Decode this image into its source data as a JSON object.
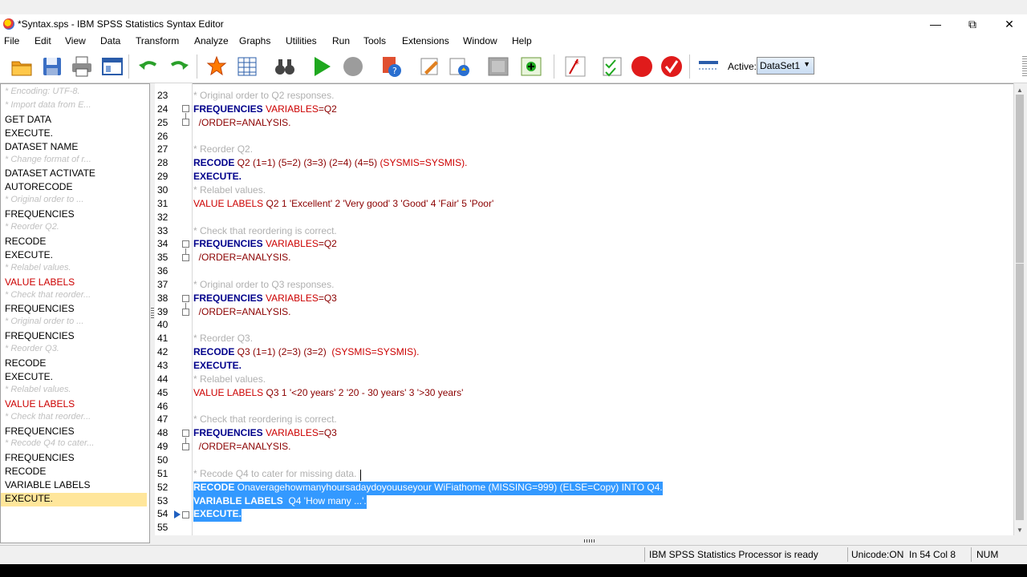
{
  "window": {
    "title": "*Syntax.sps - IBM SPSS Statistics Syntax Editor",
    "controls": {
      "minimize": "—",
      "restore": "⧉",
      "close": "✕"
    }
  },
  "menu": [
    "File",
    "Edit",
    "View",
    "Data",
    "Transform",
    "Analyze",
    "Graphs",
    "Utilities",
    "Run",
    "Tools",
    "Extensions",
    "Window",
    "Help"
  ],
  "toolbar": {
    "active_label": "Active:",
    "active_dataset": "DataSet1",
    "icons": [
      "open-icon",
      "save-icon",
      "print-icon",
      "recall-dialog-icon",
      "undo-icon",
      "redo-icon",
      "goto-case-icon",
      "variables-icon",
      "find-icon",
      "run-icon",
      "stop-icon",
      "help-icon",
      "syntax-help-icon",
      "pencil-icon",
      "bookmark-icon",
      "gray-box-icon",
      "add-icon",
      "comment-icon",
      "validate-icon",
      "breakpoint-icon",
      "check-icon",
      "line-icon"
    ]
  },
  "navigator": [
    {
      "text": "* Encoding: UTF-8.",
      "style": "grey"
    },
    {
      "text": "* Import data from E...",
      "style": "grey"
    },
    {
      "text": "GET DATA",
      "style": ""
    },
    {
      "text": "EXECUTE.",
      "style": ""
    },
    {
      "text": "DATASET NAME",
      "style": ""
    },
    {
      "text": "* Change format of r...",
      "style": "grey"
    },
    {
      "text": "DATASET ACTIVATE",
      "style": ""
    },
    {
      "text": "AUTORECODE",
      "style": ""
    },
    {
      "text": "* Original order to ...",
      "style": "grey"
    },
    {
      "text": "FREQUENCIES",
      "style": ""
    },
    {
      "text": "* Reorder Q2.",
      "style": "grey"
    },
    {
      "text": "RECODE",
      "style": ""
    },
    {
      "text": "EXECUTE.",
      "style": ""
    },
    {
      "text": "* Relabel values.",
      "style": "grey"
    },
    {
      "text": "VALUE LABELS",
      "style": "red"
    },
    {
      "text": "* Check that reorder...",
      "style": "grey"
    },
    {
      "text": "FREQUENCIES",
      "style": ""
    },
    {
      "text": "* Original order to ...",
      "style": "grey"
    },
    {
      "text": "FREQUENCIES",
      "style": ""
    },
    {
      "text": "* Reorder Q3.",
      "style": "grey"
    },
    {
      "text": "RECODE",
      "style": ""
    },
    {
      "text": "EXECUTE.",
      "style": ""
    },
    {
      "text": "* Relabel values.",
      "style": "grey"
    },
    {
      "text": "VALUE LABELS",
      "style": "red"
    },
    {
      "text": "* Check that reorder...",
      "style": "grey"
    },
    {
      "text": "FREQUENCIES",
      "style": ""
    },
    {
      "text": "* Recode Q4 to cater...",
      "style": "grey"
    },
    {
      "text": "FREQUENCIES",
      "style": ""
    },
    {
      "text": "RECODE",
      "style": ""
    },
    {
      "text": "VARIABLE LABELS",
      "style": ""
    },
    {
      "text": "EXECUTE.",
      "style": "sel"
    }
  ],
  "lines": [
    {
      "n": "23",
      "segs": [
        [
          "cm",
          "* Original order to Q2 responses."
        ]
      ]
    },
    {
      "n": "24",
      "segs": [
        [
          "kw",
          "FREQUENCIES"
        ],
        [
          "kr",
          " VARIABLES"
        ],
        [
          "tx",
          "=Q2"
        ]
      ]
    },
    {
      "n": "25",
      "segs": [
        [
          "tx",
          "  /ORDER"
        ],
        [
          "tx",
          "=ANALYSIS."
        ]
      ]
    },
    {
      "n": "26",
      "segs": []
    },
    {
      "n": "27",
      "segs": [
        [
          "cm",
          "* Reorder Q2."
        ]
      ]
    },
    {
      "n": "28",
      "segs": [
        [
          "kw",
          "RECODE"
        ],
        [
          "tx",
          " Q2 (1=1) (5=2) (3=3) (2=4) (4=5) "
        ],
        [
          "kr",
          "(SYSMIS=SYSMIS)."
        ]
      ]
    },
    {
      "n": "29",
      "segs": [
        [
          "kw",
          "EXECUTE."
        ]
      ]
    },
    {
      "n": "30",
      "segs": [
        [
          "cm",
          "* Relabel values."
        ]
      ]
    },
    {
      "n": "31",
      "segs": [
        [
          "kr",
          "VALUE LABELS"
        ],
        [
          "tx",
          " Q2 1 'Excellent' 2 'Very good' 3 'Good' 4 'Fair' 5 'Poor'"
        ]
      ]
    },
    {
      "n": "32",
      "segs": []
    },
    {
      "n": "33",
      "segs": [
        [
          "cm",
          "* Check that reordering is correct."
        ]
      ]
    },
    {
      "n": "34",
      "segs": [
        [
          "kw",
          "FREQUENCIES"
        ],
        [
          "kr",
          " VARIABLES"
        ],
        [
          "tx",
          "=Q2"
        ]
      ]
    },
    {
      "n": "35",
      "segs": [
        [
          "tx",
          "  /ORDER"
        ],
        [
          "tx",
          "=ANALYSIS."
        ]
      ]
    },
    {
      "n": "36",
      "segs": []
    },
    {
      "n": "37",
      "segs": [
        [
          "cm",
          "* Original order to Q3 responses."
        ]
      ]
    },
    {
      "n": "38",
      "segs": [
        [
          "kw",
          "FREQUENCIES"
        ],
        [
          "kr",
          " VARIABLES"
        ],
        [
          "tx",
          "=Q3"
        ]
      ]
    },
    {
      "n": "39",
      "segs": [
        [
          "tx",
          "  /ORDER"
        ],
        [
          "tx",
          "=ANALYSIS."
        ]
      ]
    },
    {
      "n": "40",
      "segs": []
    },
    {
      "n": "41",
      "segs": [
        [
          "cm",
          "* Reorder Q3."
        ]
      ]
    },
    {
      "n": "42",
      "segs": [
        [
          "kw",
          "RECODE"
        ],
        [
          "tx",
          " Q3 (1=1) (2=3) (3=2)  "
        ],
        [
          "kr",
          "(SYSMIS=SYSMIS)."
        ]
      ]
    },
    {
      "n": "43",
      "segs": [
        [
          "kw",
          "EXECUTE."
        ]
      ]
    },
    {
      "n": "44",
      "segs": [
        [
          "cm",
          "* Relabel values."
        ]
      ]
    },
    {
      "n": "45",
      "segs": [
        [
          "kr",
          "VALUE LABELS"
        ],
        [
          "tx",
          " Q3 1 '<20 years' 2 '20 - 30 years' 3 '>30 years'"
        ]
      ]
    },
    {
      "n": "46",
      "segs": []
    },
    {
      "n": "47",
      "segs": [
        [
          "cm",
          "* Check that reordering is correct."
        ]
      ]
    },
    {
      "n": "48",
      "segs": [
        [
          "kw",
          "FREQUENCIES"
        ],
        [
          "kr",
          " VARIABLES"
        ],
        [
          "tx",
          "=Q3"
        ]
      ]
    },
    {
      "n": "49",
      "segs": [
        [
          "tx",
          "  /ORDER"
        ],
        [
          "tx",
          "=ANALYSIS."
        ]
      ]
    },
    {
      "n": "50",
      "segs": []
    },
    {
      "n": "51",
      "segs": [
        [
          "cm",
          "* Recode Q4 to cater for missing data."
        ]
      ]
    },
    {
      "n": "52",
      "segs": [
        [
          "kw",
          "RECODE"
        ],
        [
          "tx",
          " Onaveragehowmanyhoursadaydoyouuseyour WiFiathome (MISSING=999) (ELSE=Copy) INTO Q4."
        ]
      ],
      "sel": true
    },
    {
      "n": "53",
      "segs": [
        [
          "kw",
          "VARIABLE LABELS"
        ],
        [
          "tx",
          "  Q4 'How many ...'."
        ]
      ],
      "sel": true
    },
    {
      "n": "54",
      "segs": [
        [
          "kw",
          "EXECUTE."
        ]
      ],
      "sel": true
    },
    {
      "n": "55",
      "segs": []
    }
  ],
  "status": {
    "processor": "IBM SPSS Statistics Processor is ready",
    "unicode": "Unicode:ON",
    "position": "In 54 Col 8",
    "num": "NUM"
  }
}
